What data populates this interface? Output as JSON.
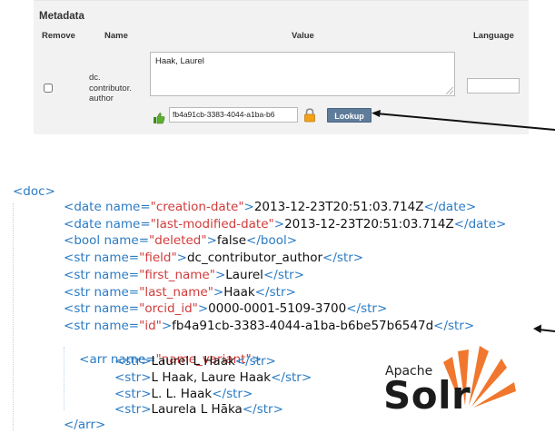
{
  "metadata_form": {
    "title": "Metadata",
    "columns": {
      "remove": "Remove",
      "name": "Name",
      "value": "Value",
      "language": "Language"
    },
    "row": {
      "field_name": "dc.\ncontributor.\nauthor",
      "value": "Haak, Laurel",
      "language_value": "",
      "authority_id": "fb4a91cb-3383-4044-a1ba-b6",
      "lookup_label": "Lookup",
      "icons": {
        "accepted": "thumbs-up-icon",
        "locked": "lock-icon"
      }
    }
  },
  "solr_doc": {
    "open_tag": "<doc>",
    "fields": [
      {
        "type": "date",
        "name": "creation-date",
        "value": "2013-12-23T20:51:03.714Z"
      },
      {
        "type": "date",
        "name": "last-modified-date",
        "value": "2013-12-23T20:51:03.714Z"
      },
      {
        "type": "bool",
        "name": "deleted",
        "value": "false"
      },
      {
        "type": "str",
        "name": "field",
        "value": "dc_contributor_author"
      },
      {
        "type": "str",
        "name": "first_name",
        "value": "Laurel"
      },
      {
        "type": "str",
        "name": "last_name",
        "value": "Haak"
      },
      {
        "type": "str",
        "name": "orcid_id",
        "value": "0000-0001-5109-3700"
      },
      {
        "type": "str",
        "name": "id",
        "value": "fb4a91cb-3383-4044-a1ba-b6be57b6547d"
      }
    ],
    "array": {
      "type": "arr",
      "name": "name_variant",
      "items": [
        "Laurel L Haak",
        "L Haak, Laure Haak",
        "L. L. Haak",
        "Laurela L Hāka"
      ],
      "close_tag": "</arr>"
    }
  },
  "logo": {
    "top_text": "Apache",
    "word": "Solr"
  },
  "colors": {
    "xml_tag": "#2b7bc4",
    "xml_attr_value": "#d13b3b",
    "lookup_button": "#5f7c9b",
    "solr_orange": "#f0772d"
  }
}
